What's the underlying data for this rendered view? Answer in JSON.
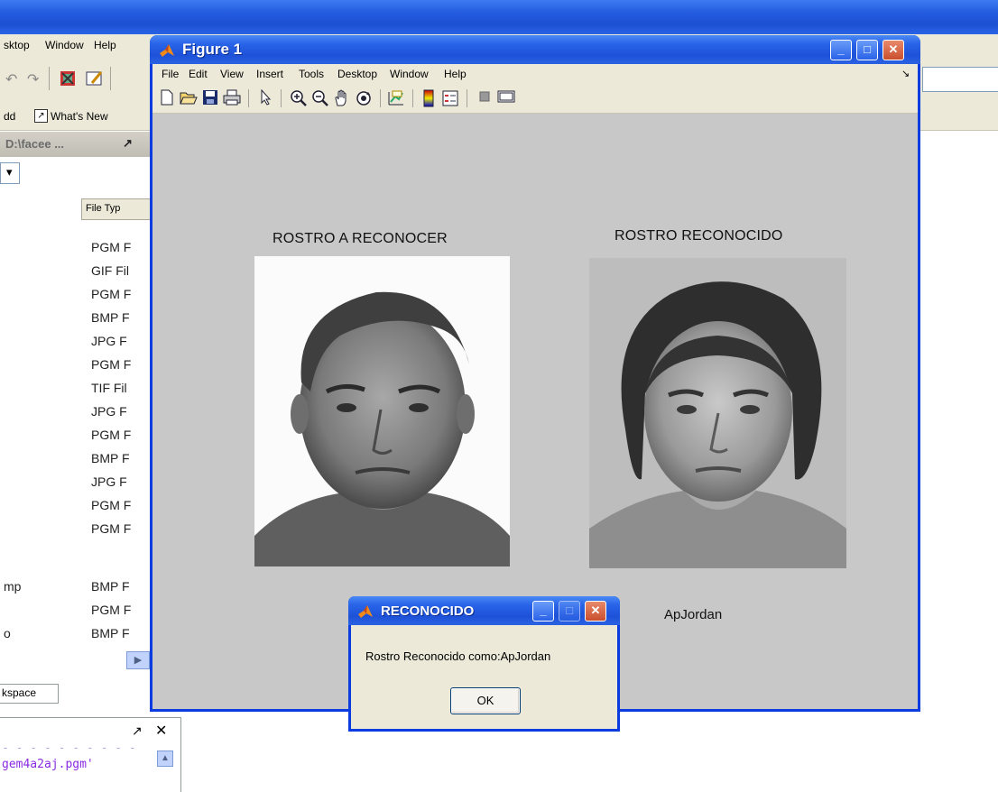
{
  "desktop": {
    "menu": [
      "sktop",
      "Window",
      "Help"
    ],
    "shortcuts": [
      "dd",
      "What's New"
    ],
    "folder_title": "D:\\facee ...",
    "column_header": "File Typ",
    "file_types": [
      "PGM F",
      "GIF Fil",
      "PGM F",
      "BMP F",
      "JPG F",
      "PGM F",
      "TIF Fil",
      "JPG F",
      "PGM F",
      "BMP F",
      "JPG F",
      "PGM F",
      "PGM F",
      "BMP F",
      "PGM F",
      "BMP F"
    ],
    "file_names": [
      "mp",
      "",
      "o"
    ],
    "workspace_tab": "kspace",
    "history_line": "gem4a2aj.pgm'"
  },
  "figure": {
    "title": "Figure 1",
    "menu": [
      "File",
      "Edit",
      "View",
      "Insert",
      "Tools",
      "Desktop",
      "Window",
      "Help"
    ],
    "left_title": "ROSTRO A RECONOCER",
    "right_title": "ROSTRO RECONOCIDO",
    "result_name": "ApJordan"
  },
  "dialog": {
    "title": "RECONOCIDO",
    "message": "Rostro Reconocido como:ApJordan",
    "ok_label": "OK"
  },
  "icons": {
    "figure_toolbar": [
      "new-file-icon",
      "open-folder-icon",
      "save-icon",
      "print-icon",
      "arrow-pointer-icon",
      "zoom-in-icon",
      "zoom-out-icon",
      "pan-hand-icon",
      "rotate-3d-icon",
      "data-cursor-icon",
      "colorbar-icon",
      "legend-icon",
      "hide-plot-tools-icon",
      "show-plot-tools-icon"
    ]
  },
  "colors": {
    "xp_title_blue": "#245de0",
    "figure_background": "#c8c8c8",
    "dialog_background": "#ece9d8"
  }
}
